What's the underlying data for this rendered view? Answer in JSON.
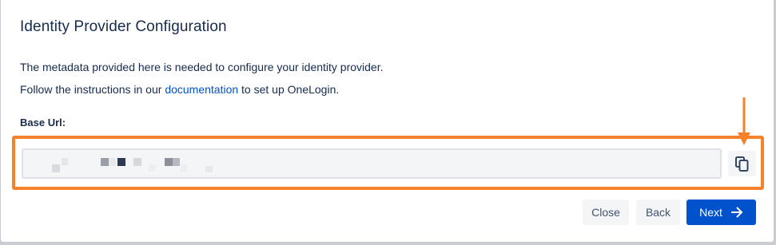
{
  "dialog": {
    "title": "Identity Provider Configuration",
    "description_line1": "The metadata provided here is needed to configure your identity provider.",
    "description_line2_before": "Follow the instructions in our ",
    "description_line2_link": "documentation",
    "description_line2_after": " to set up OneLogin."
  },
  "base_url": {
    "label": "Base Url:",
    "value": "",
    "redacted": true
  },
  "copy_button": {
    "icon": "copy-icon"
  },
  "footer": {
    "close_label": "Close",
    "back_label": "Back",
    "next_label": "Next",
    "next_icon": "arrow-right-icon"
  },
  "annotation": {
    "highlight_color": "#f5822a",
    "arrow_icon": "arrow-down-icon"
  },
  "colors": {
    "primary": "#0052cc",
    "text": "#172b4d",
    "link": "#0052cc",
    "subtle_button_bg": "#f4f5f7"
  }
}
